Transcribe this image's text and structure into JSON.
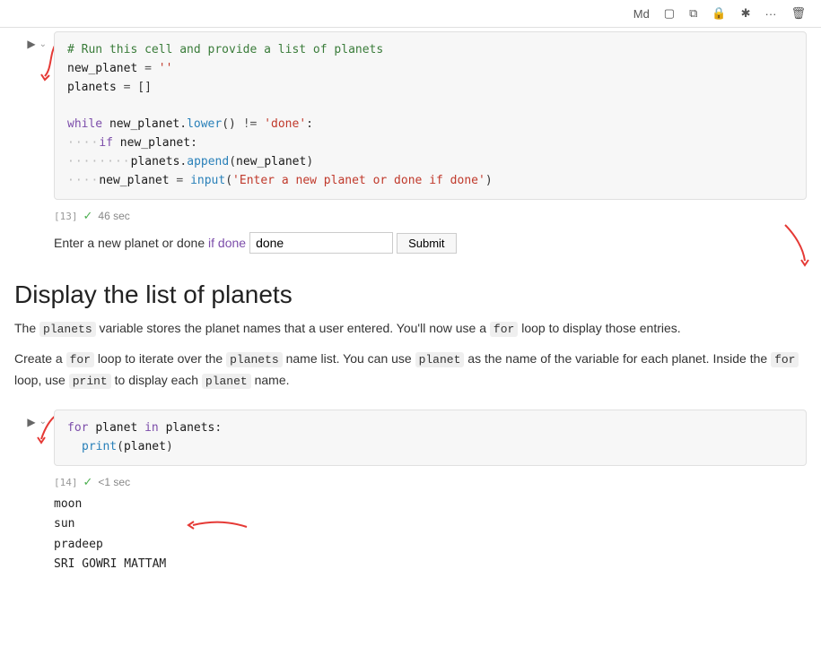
{
  "toolbar": {
    "buttons": [
      "Md",
      "□",
      "⧉",
      "🔒",
      "✳",
      "···",
      "🗑"
    ]
  },
  "cell13": {
    "number": "[13]",
    "time": "46 sec",
    "comment": "# Run this cell and provide a list of planets",
    "code_lines": [
      "new_planet = ''",
      "planets = []",
      "",
      "while new_planet.lower() != 'done':",
      "    if new_planet:",
      "        planets.append(new_planet)",
      "    new_planet = input('Enter a new planet or done if done')"
    ]
  },
  "input_row": {
    "label": "Enter a new planet or done if done",
    "highlight_words": [
      "if",
      "done"
    ],
    "value": "done",
    "button_label": "Submit"
  },
  "section": {
    "title": "Display the list of planets"
  },
  "prose1": {
    "text": "The",
    "code1": "planets",
    "text2": "variable stores the planet names that a user entered. You'll now use a",
    "code2": "for",
    "text3": "loop to display those entries."
  },
  "prose2": {
    "text1": "Create a",
    "code1": "for",
    "text2": "loop to iterate over the",
    "code2": "planets",
    "text3": "name list. You can use",
    "code3": "planet",
    "text4": "as the name of the variable for each planet. Inside the",
    "code4": "for",
    "text5": "loop, use",
    "code5": "print",
    "text6": "to display each",
    "code6": "planet",
    "text7": "name."
  },
  "cell14": {
    "number": "[14]",
    "time": "<1 sec",
    "code_lines": [
      "for planet in planets:",
      "    print(planet)"
    ]
  },
  "output": {
    "lines": [
      "moon",
      "sun",
      "pradeep",
      "SRI GOWRI MATTAM"
    ]
  }
}
